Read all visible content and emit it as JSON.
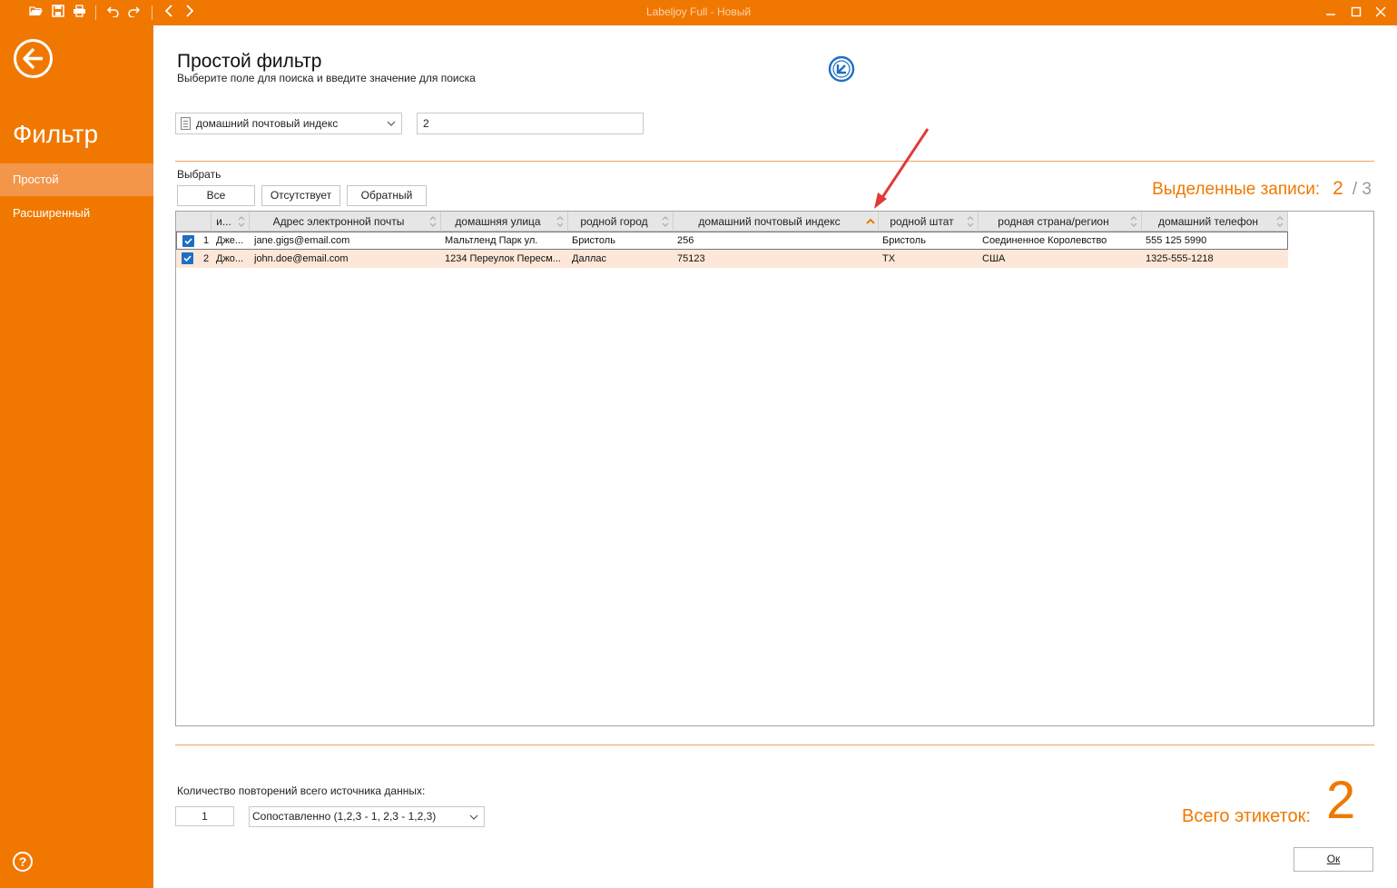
{
  "window": {
    "title": "Labeljoy Full - Новый"
  },
  "toolbar": {
    "icons": [
      "folder-open-icon",
      "save-icon",
      "print-icon",
      "undo-icon",
      "redo-icon",
      "nav-back-icon",
      "nav-forward-icon"
    ]
  },
  "sidebar": {
    "heading": "Фильтр",
    "items": [
      {
        "label": "Простой",
        "active": true
      },
      {
        "label": "Расширенный",
        "active": false
      }
    ],
    "help": "?"
  },
  "header": {
    "title": "Простой фильтр",
    "subtitle": "Выберите поле для поиска и введите значение для поиска"
  },
  "filter": {
    "field": "домашний почтовый индекс",
    "value": "2"
  },
  "selection": {
    "label": "Выбрать",
    "buttons": [
      "Все",
      "Отсутствует",
      "Обратный"
    ],
    "count_label": "Выделенные записи:",
    "selected": "2",
    "total": "3"
  },
  "grid": {
    "columns": [
      "и...",
      "Адрес электронной почты",
      "домашняя улица",
      "родной город",
      "домашний почтовый индекс",
      "родной штат",
      "родная страна/регион",
      "домашний телефон"
    ],
    "sorted_column": "домашний почтовый индекс",
    "sort_direction": "ascending",
    "rows": [
      {
        "checked": true,
        "num": "1",
        "cells": [
          "Дже...",
          "jane.gigs@email.com",
          "Мальтленд Парк ул.",
          "Бристоль",
          "256",
          "Бристоль",
          "Соединенное Королевство",
          "555 125 5990"
        ]
      },
      {
        "checked": true,
        "num": "2",
        "cells": [
          "Джо...",
          "john.doe@email.com",
          "1234 Переулок Пересм...",
          "Даллас",
          "75123",
          "TX",
          "США",
          "1325-555-1218"
        ]
      }
    ]
  },
  "footer": {
    "repeat_label": "Количество повторений всего источника данных:",
    "repeat_value": "1",
    "collation": "Сопоставленно (1,2,3 - 1, 2,3 - 1,2,3)",
    "total_label": "Всего этикеток:",
    "total_value": "2",
    "ok_label": "Ок"
  },
  "colors": {
    "accent": "#f07800",
    "selected_row": "#fde7d8",
    "checkbox": "#1f6ec4",
    "annotation_arrow": "#e03a3a"
  }
}
